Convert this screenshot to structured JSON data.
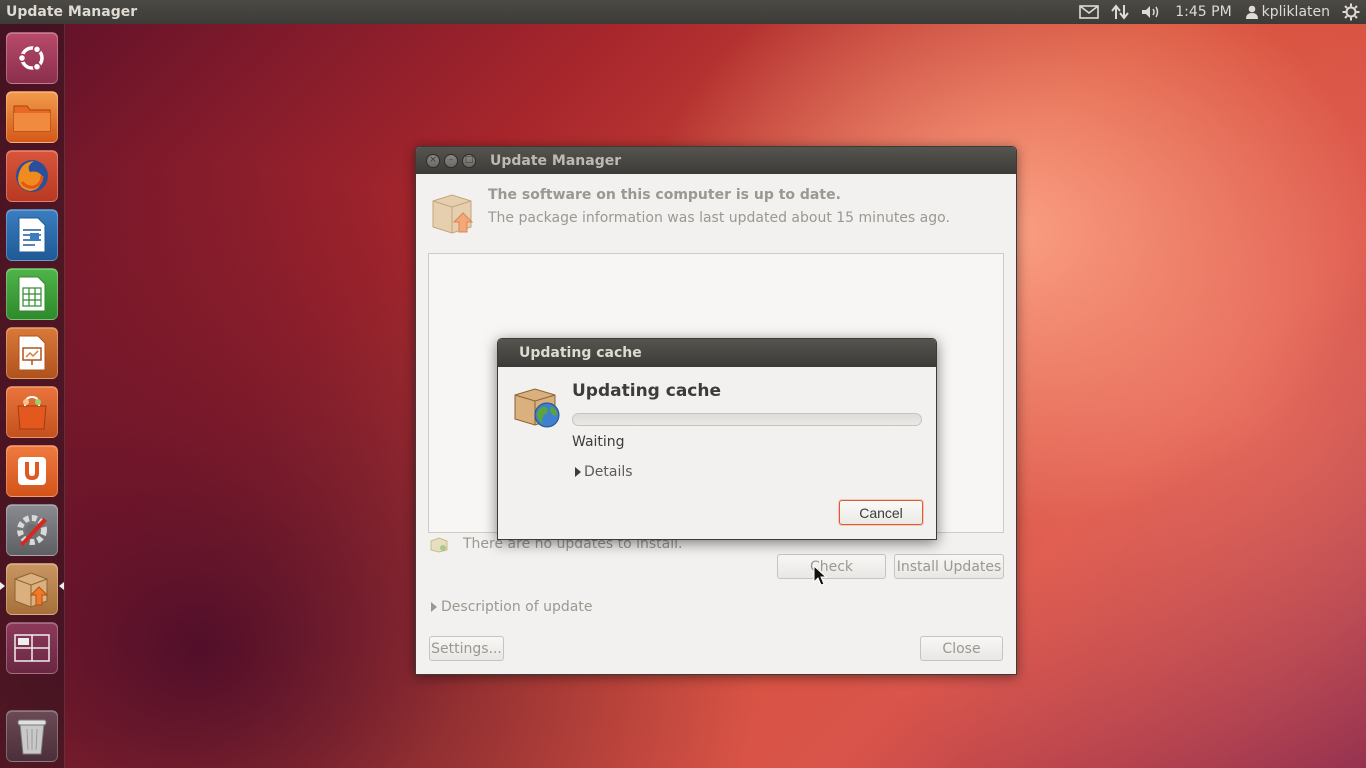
{
  "panel": {
    "app_title": "Update Manager",
    "clock": "1:45 PM",
    "username": "kpliklaten",
    "indicators": [
      "mail-icon",
      "network-icon",
      "volume-icon",
      "session-gear-icon"
    ]
  },
  "launcher": {
    "items": [
      {
        "name": "dash-home",
        "icon": "ubuntu-logo-icon"
      },
      {
        "name": "files",
        "icon": "folder-icon"
      },
      {
        "name": "firefox",
        "icon": "firefox-icon"
      },
      {
        "name": "libreoffice-writer",
        "icon": "writer-document-icon"
      },
      {
        "name": "libreoffice-calc",
        "icon": "calc-spreadsheet-icon"
      },
      {
        "name": "libreoffice-impress",
        "icon": "impress-presentation-icon"
      },
      {
        "name": "ubuntu-software-center",
        "icon": "shopping-bag-icon"
      },
      {
        "name": "ubuntu-one",
        "icon": "ubuntu-one-icon"
      },
      {
        "name": "system-settings",
        "icon": "settings-wrench-icon"
      },
      {
        "name": "update-manager",
        "icon": "package-update-icon",
        "active": true
      },
      {
        "name": "workspace-switcher",
        "icon": "workspaces-icon"
      },
      {
        "name": "trash",
        "icon": "trash-icon"
      }
    ]
  },
  "update_window": {
    "title": "Update Manager",
    "status_title": "The software on this computer is up to date.",
    "status_subtitle": "The package information was last updated about 15 minutes ago.",
    "no_updates_text": "There are no updates to install.",
    "check_label": "Check",
    "install_label": "Install Updates",
    "description_label": "Description of update",
    "settings_label": "Settings...",
    "close_label": "Close"
  },
  "cache_dialog": {
    "title": "Updating cache",
    "heading": "Updating cache",
    "progress": 0,
    "status": "Waiting",
    "details_label": "Details",
    "cancel_label": "Cancel"
  },
  "colors": {
    "accent": "#e05a2b",
    "panel_bg": "#3c3b37",
    "window_bg": "#f2f1f0"
  }
}
